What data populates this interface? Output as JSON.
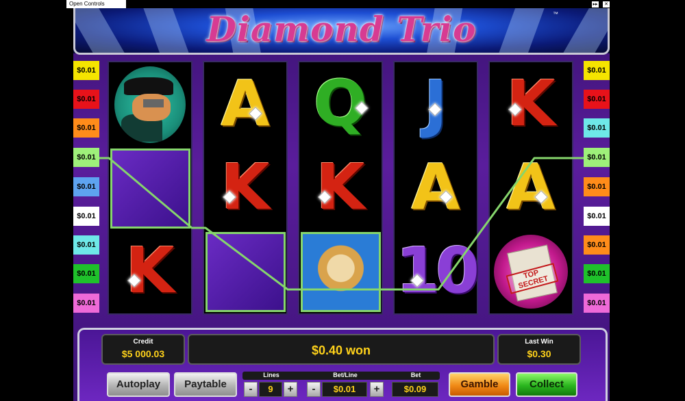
{
  "top_bar": {
    "open_controls_label": "Open Controls",
    "icons": [
      "fast-forward-icon",
      "sound-muted-icon"
    ]
  },
  "game": {
    "title": "Diamond Trio",
    "trademark": "™"
  },
  "line_markers": {
    "left": [
      {
        "value": "$0.01",
        "color": "#f5e400"
      },
      {
        "value": "$0.01",
        "color": "#e8121a"
      },
      {
        "value": "$0.01",
        "color": "#ff8c1a"
      },
      {
        "value": "$0.01",
        "color": "#9ef07a"
      },
      {
        "value": "$0.01",
        "color": "#5ea3f0"
      },
      {
        "value": "$0.01",
        "color": "#ffffff"
      },
      {
        "value": "$0.01",
        "color": "#6ee8e8"
      },
      {
        "value": "$0.01",
        "color": "#1fc12b"
      },
      {
        "value": "$0.01",
        "color": "#ee6ad8"
      }
    ],
    "right": [
      {
        "value": "$0.01",
        "color": "#f5e400"
      },
      {
        "value": "$0.01",
        "color": "#e8121a"
      },
      {
        "value": "$0.01",
        "color": "#6ee8e8"
      },
      {
        "value": "$0.01",
        "color": "#9ef07a"
      },
      {
        "value": "$0.01",
        "color": "#ff8c1a"
      },
      {
        "value": "$0.01",
        "color": "#ffffff"
      },
      {
        "value": "$0.01",
        "color": "#ff8c1a"
      },
      {
        "value": "$0.01",
        "color": "#1fc12b"
      },
      {
        "value": "$0.01",
        "color": "#ee6ad8"
      }
    ]
  },
  "reels": [
    [
      "spy-agent",
      "wild-diamond",
      "K"
    ],
    [
      "A",
      "K",
      "wild-diamond"
    ],
    [
      "Q",
      "K",
      "blonde-woman"
    ],
    [
      "J",
      "A",
      "10"
    ],
    [
      "K",
      "A",
      "top-secret"
    ]
  ],
  "symbols": {
    "A": "A",
    "K": "K",
    "Q": "Q",
    "J": "J",
    "10": "10",
    "top_secret_stamp": "TOP SECRET"
  },
  "panel": {
    "credit_label": "Credit",
    "credit_value": "$5 000.03",
    "message": "$0.40 won",
    "last_win_label": "Last Win",
    "last_win_value": "$0.30",
    "autoplay_label": "Autoplay",
    "paytable_label": "Paytable",
    "lines_label": "Lines",
    "lines_value": "9",
    "bet_line_label": "Bet/Line",
    "bet_line_value": "$0.01",
    "bet_label": "Bet",
    "bet_value": "$0.09",
    "gamble_label": "Gamble",
    "collect_label": "Collect",
    "minus": "-",
    "plus": "+"
  },
  "colors": {
    "win_line": "#86d66c",
    "accent_yellow": "#ffd21a"
  }
}
